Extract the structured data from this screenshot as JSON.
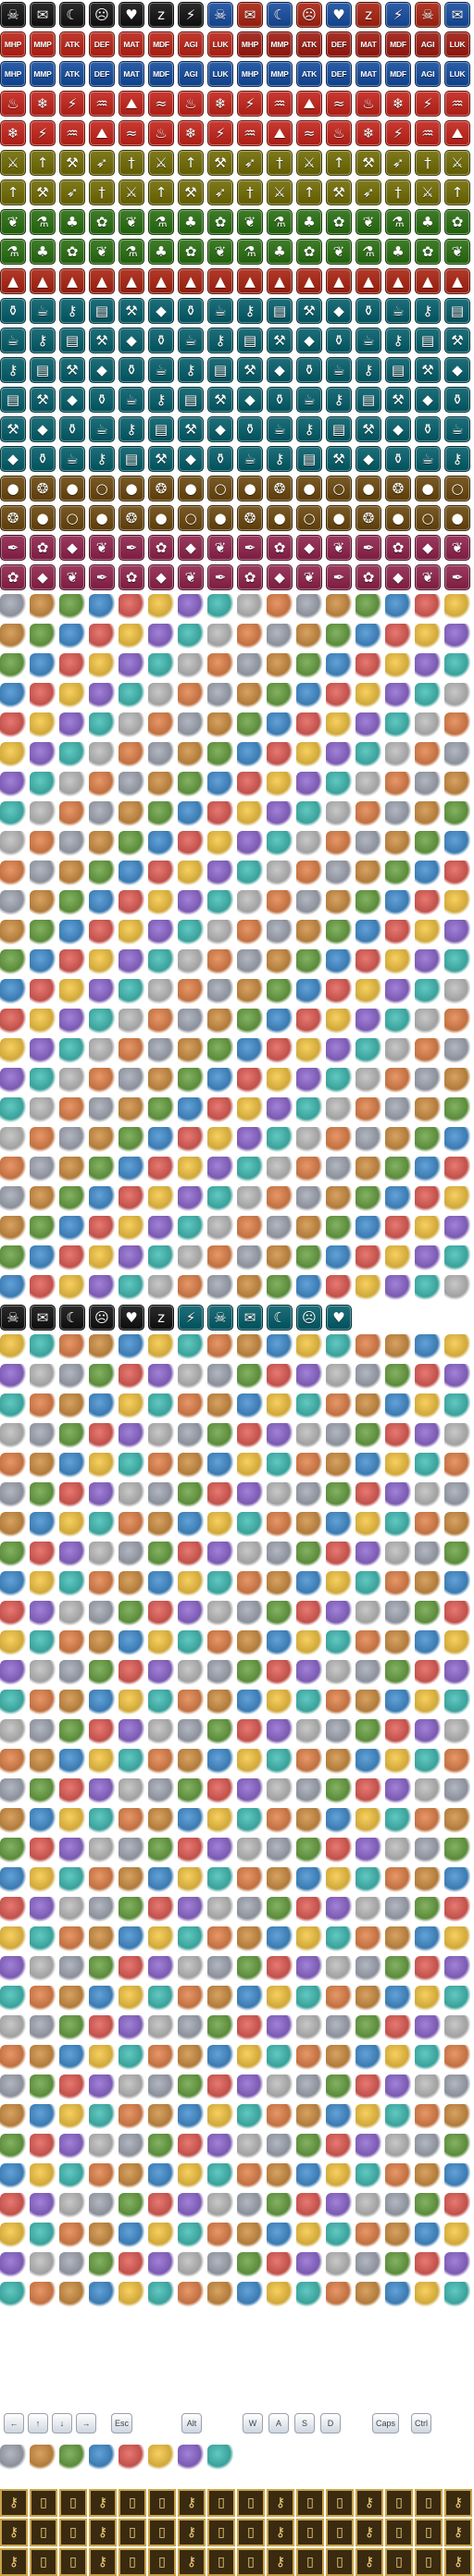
{
  "sheet": {
    "stat_labels": [
      "MHP",
      "MMP",
      "ATK",
      "DEF",
      "MAT",
      "MDF",
      "AGI",
      "LUK"
    ],
    "key_labels": [
      "Esc",
      "Alt",
      "W",
      "A",
      "S",
      "D",
      "Caps",
      "Ctrl"
    ],
    "icon_sets": [
      {
        "id": "status",
        "color": "#2b2b2b",
        "icons": [
          "skull-icon",
          "speech-bubble-icon",
          "sleep-icon",
          "frown-icon",
          "heart-broken-icon",
          "zzz-icon",
          "lightning-icon"
        ]
      },
      {
        "id": "buff",
        "color": "#b13a2a",
        "icons": [
          "sword-up-icon",
          "shield-up-icon"
        ]
      },
      {
        "id": "debuff",
        "color": "#2f5fa8",
        "icons": [
          "sword-down-icon",
          "shield-down-icon"
        ]
      },
      {
        "id": "skill-red",
        "color": "#c83a32",
        "icons": [
          "fire-icon",
          "ice-icon",
          "thunder-icon",
          "water-icon",
          "earth-icon",
          "wind-icon"
        ]
      },
      {
        "id": "skill-olive",
        "color": "#7f7a1e",
        "icons": [
          "sword-icon",
          "spear-icon",
          "axe-icon",
          "bow-icon",
          "dagger-icon"
        ]
      },
      {
        "id": "skill-green",
        "color": "#3f7d2a",
        "icons": [
          "leaf-icon",
          "potion-icon",
          "clover-icon",
          "flower-icon"
        ]
      },
      {
        "id": "item-teal",
        "color": "#1f6f7a",
        "icons": [
          "bottle-icon",
          "food-icon",
          "key-icon",
          "book-icon",
          "tool-icon",
          "gem-icon"
        ]
      },
      {
        "id": "item-brown",
        "color": "#7a5a26",
        "icons": [
          "bread-icon",
          "meat-icon",
          "fruit-icon",
          "egg-icon"
        ]
      },
      {
        "id": "item-pink",
        "color": "#9a3a5e",
        "icons": [
          "feather-icon",
          "flower-icon",
          "crystal-icon",
          "leaf-icon"
        ]
      }
    ]
  }
}
